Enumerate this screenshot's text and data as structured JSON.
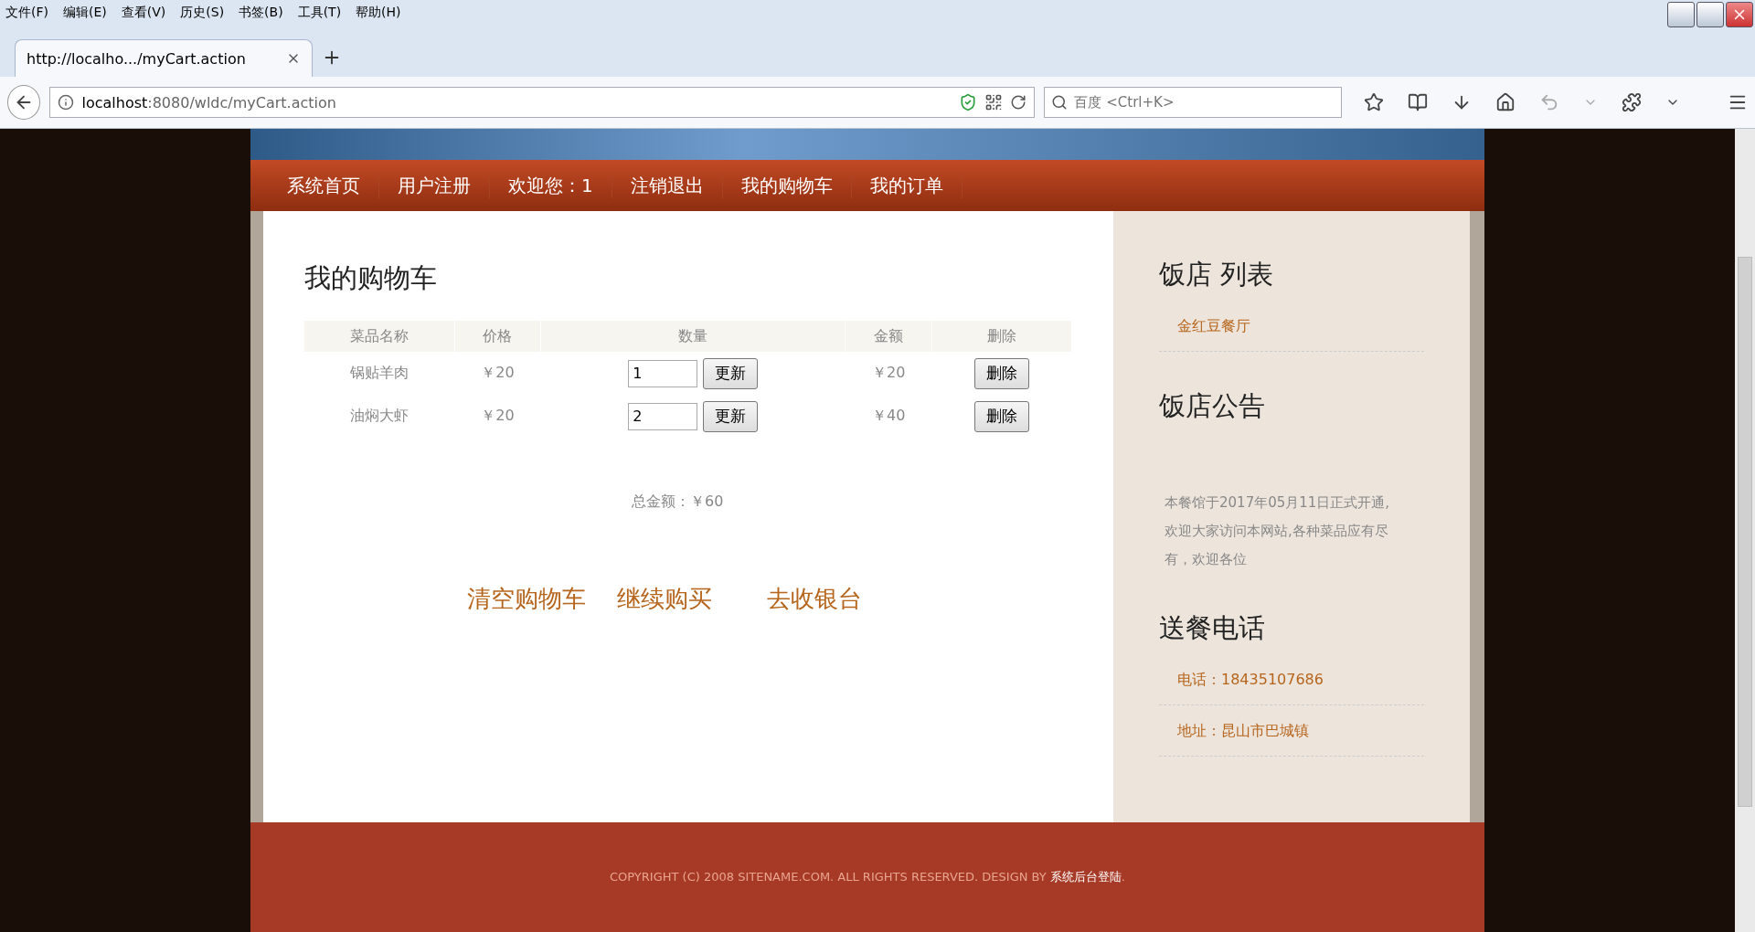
{
  "menu_bar": [
    "文件(F)",
    "编辑(E)",
    "查看(V)",
    "历史(S)",
    "书签(B)",
    "工具(T)",
    "帮助(H)"
  ],
  "tabs": [
    {
      "label": "http://localho.../myCart.action",
      "selected": true
    }
  ],
  "address_bar": {
    "host": "localhost",
    "path": ":8080/wldc/myCart.action"
  },
  "search": {
    "placeholder": "百度 <Ctrl+K>"
  },
  "nav": [
    "系统首页",
    "用户注册",
    "欢迎您：1",
    "注销退出",
    "我的购物车",
    "我的订单"
  ],
  "cart": {
    "title": "我的购物车",
    "columns": [
      "菜品名称",
      "价格",
      "数量",
      "金额",
      "删除"
    ],
    "rows": [
      {
        "name": "锅贴羊肉",
        "price": "￥20",
        "quantity": "1",
        "update": "更新",
        "amount": "￥20",
        "delete": "删除"
      },
      {
        "name": "油焖大虾",
        "price": "￥20",
        "quantity": "2",
        "update": "更新",
        "amount": "￥40",
        "delete": "删除"
      }
    ],
    "total": "总金额：￥60",
    "actions": [
      "清空购物车",
      "继续购买",
      "去收银台"
    ]
  },
  "sidebar": [
    {
      "title": "饭店 列表",
      "kind": "links",
      "items": [
        "金红豆餐厅"
      ]
    },
    {
      "title": "饭店公告",
      "kind": "text",
      "text": "本餐馆于2017年05月11日正式开通,欢迎大家访问本网站,各种菜品应有尽有，欢迎各位"
    },
    {
      "title": "送餐电话",
      "kind": "links",
      "items": [
        "电话：18435107686",
        "地址：昆山市巴城镇"
      ]
    }
  ],
  "footer": {
    "text": "COPYRIGHT (C) 2008 SITENAME.COM. ALL RIGHTS RESERVED. DESIGN BY ",
    "link": "系统后台登陆",
    "end": "."
  }
}
